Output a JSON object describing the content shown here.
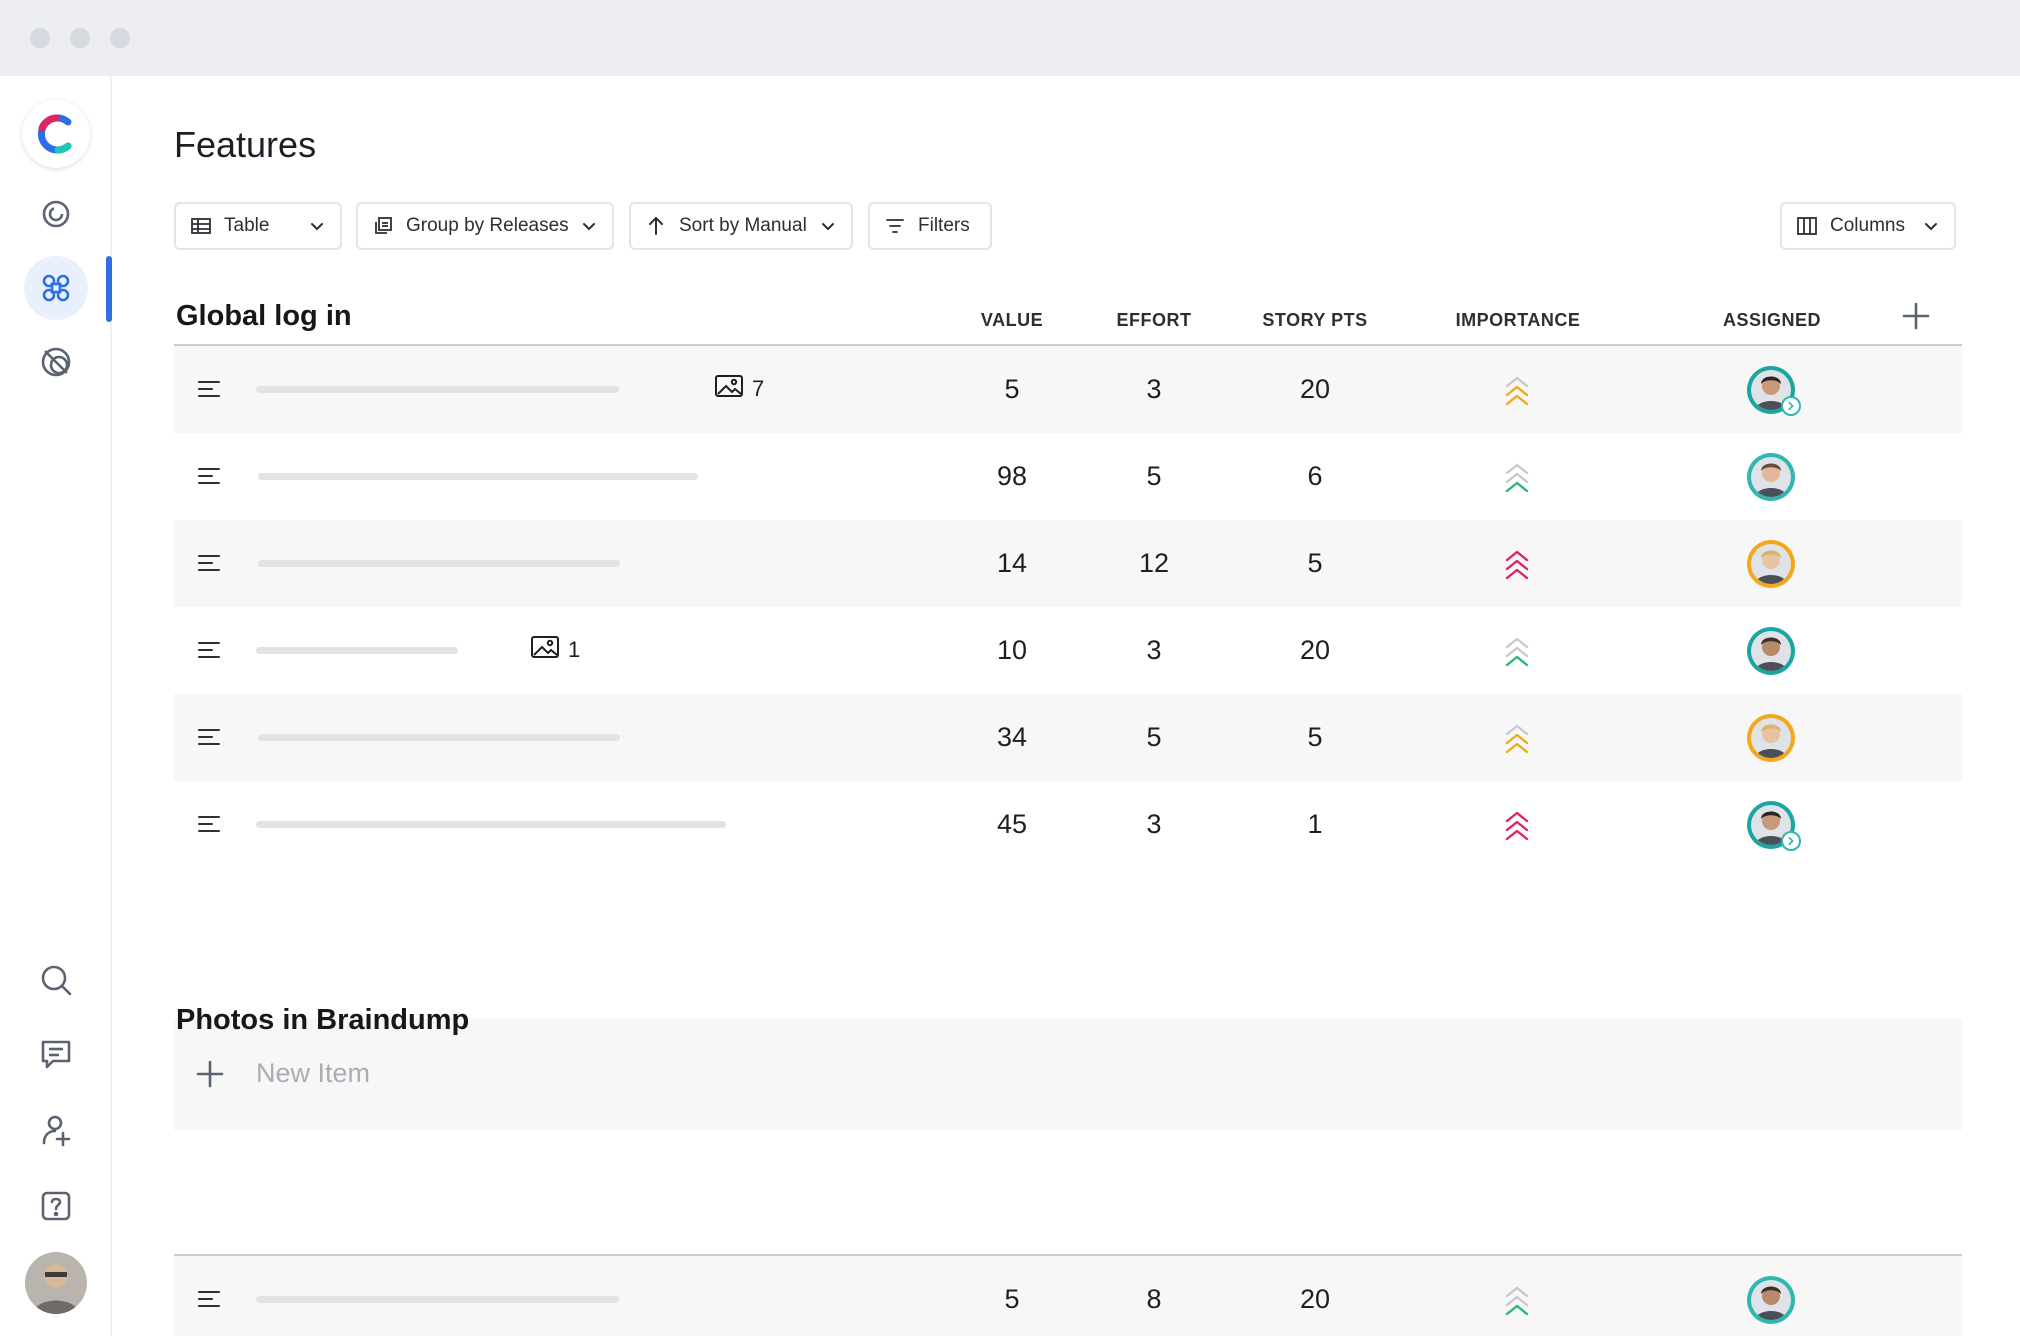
{
  "app": {
    "page_title": "Features",
    "accent_color": "#2f6fe0"
  },
  "rail": {
    "items": [
      "logo-icon",
      "orbit-icon",
      "command-icon",
      "overlap-circles-icon",
      "search-icon",
      "message-icon",
      "add-user-icon",
      "help-icon",
      "avatar"
    ]
  },
  "toolbar": {
    "view_label": "Table",
    "group_label": "Group by Releases",
    "sort_label": "Sort by Manual",
    "filters_label": "Filters",
    "columns_label": "Columns"
  },
  "columns": {
    "value": "VALUE",
    "effort": "EFFORT",
    "story_pts": "STORY PTS",
    "importance": "IMPORTANCE",
    "assigned": "ASSIGNED"
  },
  "groups": [
    {
      "title": "Global log in",
      "rows": [
        {
          "attachments": "7",
          "value": "5",
          "effort": "3",
          "story_pts": "20",
          "importance": "medium",
          "importance_color": "#f2a81d",
          "assignee_ring": "#1aa5a0"
        },
        {
          "attachments": "",
          "value": "98",
          "effort": "5",
          "story_pts": "6",
          "importance": "low",
          "importance_color": "#2bb673",
          "assignee_ring": "#2fb7b0"
        },
        {
          "attachments": "",
          "value": "14",
          "effort": "12",
          "story_pts": "5",
          "importance": "high",
          "importance_color": "#e0245e",
          "assignee_ring": "#f2a81d"
        },
        {
          "attachments": "1",
          "value": "10",
          "effort": "3",
          "story_pts": "20",
          "importance": "low",
          "importance_color": "#2bb673",
          "assignee_ring": "#1aa5a0"
        },
        {
          "attachments": "",
          "value": "34",
          "effort": "5",
          "story_pts": "5",
          "importance": "medium",
          "importance_color": "#f2a81d",
          "assignee_ring": "#f2a81d"
        },
        {
          "attachments": "",
          "value": "45",
          "effort": "3",
          "story_pts": "1",
          "importance": "high",
          "importance_color": "#e0245e",
          "assignee_ring": "#1aa5a0"
        }
      ],
      "new_item_label": "New Item"
    },
    {
      "title": "Photos in Braindump",
      "rows": [
        {
          "attachments": "",
          "value": "5",
          "effort": "8",
          "story_pts": "20",
          "importance": "low",
          "importance_color": "#2bb673",
          "assignee_ring": "#2fb7b0"
        }
      ]
    }
  ]
}
